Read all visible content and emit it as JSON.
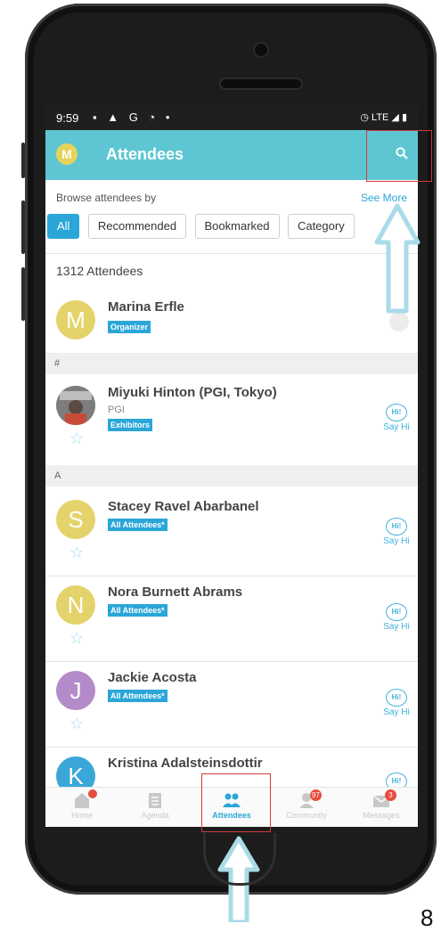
{
  "status": {
    "time": "9:59",
    "icons": "▪ ▲ G ◔ •",
    "right": "◷ LTE ◢ ▮"
  },
  "appbar": {
    "logo": "M",
    "title": "Attendees"
  },
  "browse": {
    "label": "Browse attendees by",
    "see_more": "See More"
  },
  "filters": [
    "All",
    "Recommended",
    "Bookmarked",
    "Category"
  ],
  "count": "1312 Attendees",
  "sections": {
    "hash": "#",
    "a": "A"
  },
  "attendees": [
    {
      "initial": "M",
      "name": "Marina Erfle",
      "sub": "",
      "tag": "Organizer",
      "color": "#e4d36a"
    },
    {
      "initial": "",
      "name": "Miyuki Hinton (PGI, Tokyo)",
      "sub": "PGI",
      "tag": "Exhibitors",
      "color": "#8a8a8a"
    },
    {
      "initial": "S",
      "name": "Stacey Ravel Abarbanel",
      "sub": "",
      "tag": "All Attendees*",
      "color": "#e4d36a"
    },
    {
      "initial": "N",
      "name": "Nora Burnett Abrams",
      "sub": "",
      "tag": "All Attendees*",
      "color": "#e4d36a"
    },
    {
      "initial": "J",
      "name": "Jackie Acosta",
      "sub": "",
      "tag": "All Attendees*",
      "color": "#b38bc9"
    },
    {
      "initial": "K",
      "name": "Kristina Adalsteinsdottir",
      "sub": "",
      "tag": "",
      "color": "#3aa7d8"
    }
  ],
  "sayhi": {
    "bubble": "Hi!",
    "label": "Say Hi"
  },
  "nav": [
    {
      "label": "Home",
      "badge": ""
    },
    {
      "label": "Agenda",
      "badge": ""
    },
    {
      "label": "Attendees",
      "badge": ""
    },
    {
      "label": "Community",
      "badge": "97"
    },
    {
      "label": "Messages",
      "badge": "3"
    }
  ],
  "corner_text": "8",
  "colors": {
    "accent": "#5ec6d3",
    "link": "#2aa6d8",
    "arrow": "#a9dbe8",
    "highlight": "#d23a3a"
  }
}
